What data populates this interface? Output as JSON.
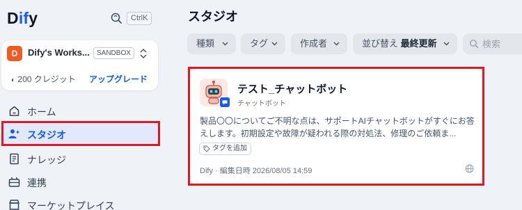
{
  "app": {
    "logo_prefix": "D",
    "logo_mid": "if",
    "logo_suffix": "y",
    "shortcut": "CtrlK"
  },
  "workspace": {
    "avatar_letter": "D",
    "name": "Dify's Works...",
    "plan_badge": "SANDBOX",
    "credits": "200 クレジット",
    "credits_icon": "coin-icon",
    "upgrade_label": "アップグレード"
  },
  "nav": {
    "items": [
      {
        "label": "ホーム",
        "icon": "home-icon"
      },
      {
        "label": "スタジオ",
        "icon": "studio-icon",
        "active": true
      },
      {
        "label": "ナレッジ",
        "icon": "book-icon"
      },
      {
        "label": "連携",
        "icon": "integration-icon"
      },
      {
        "label": "マーケットプレイス",
        "icon": "marketplace-icon"
      }
    ]
  },
  "main": {
    "title": "スタジオ",
    "filters": {
      "type_label": "種類",
      "tag_label": "タグ",
      "creator_label": "作成者",
      "sort_label": "並び替え",
      "sort_value": "最終更新",
      "search_placeholder": "検索"
    },
    "card": {
      "title": "テスト_チャットボット",
      "type": "チャットボット",
      "description": "製品〇〇についてご不明な点は、サポートAIチャットボットがすぐにお答えします。初期設定や故障が疑われる際の対処法、修理のご依頼ま...",
      "tag_button": "タグを追加",
      "meta": "Dify · 編集日時 2026/08/05 14:59",
      "visibility_icon": "globe-icon"
    }
  },
  "colors": {
    "accent": "#155aef",
    "highlight": "#e0181f",
    "workspace_avatar": "#f05a23",
    "background": "#eff2f6"
  }
}
